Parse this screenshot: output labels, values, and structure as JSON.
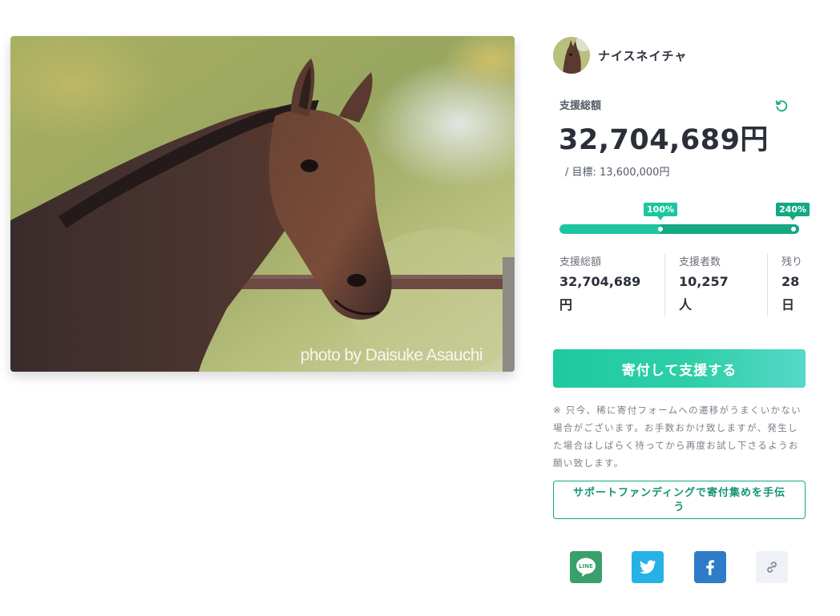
{
  "hero": {
    "credit": "photo by Daisuke Asauchi"
  },
  "profile": {
    "name": "ナイスネイチャ"
  },
  "funding": {
    "total_label": "支援総額",
    "total_amount": "32,704,689円",
    "target": "/ 目標: 13,600,000円",
    "progress": {
      "goal_marker": "100%",
      "current_marker": "240%",
      "goal_percent": 100,
      "current_percent": 240
    }
  },
  "stats": {
    "total": {
      "label": "支援総額",
      "value_line1": "32,704,689",
      "value_line2": "円"
    },
    "supporters": {
      "label": "支援者数",
      "value_line1": "10,257",
      "value_line2": "人"
    },
    "remaining": {
      "label": "残り",
      "value_line1": "28",
      "value_line2": "日"
    }
  },
  "actions": {
    "donate_label": "寄付して支援する",
    "note": "※ 只今、稀に寄付フォームへの遷移がうまくいかない場合がございます。お手数おかけ致しますが、発生した場合はしばらく待ってから再度お試し下さるようお願い致します。",
    "support_funding_label": "サポートファンディングで寄付集めを手伝う"
  },
  "share": {
    "line_label": "LINE",
    "icons": [
      "line-icon",
      "twitter-icon",
      "facebook-icon",
      "link-icon"
    ]
  },
  "colors": {
    "accent": "#1cc7a0",
    "accent_dark": "#13a983",
    "line": "#3aa06b",
    "twitter": "#25b3e6",
    "facebook": "#2e7bc8"
  }
}
